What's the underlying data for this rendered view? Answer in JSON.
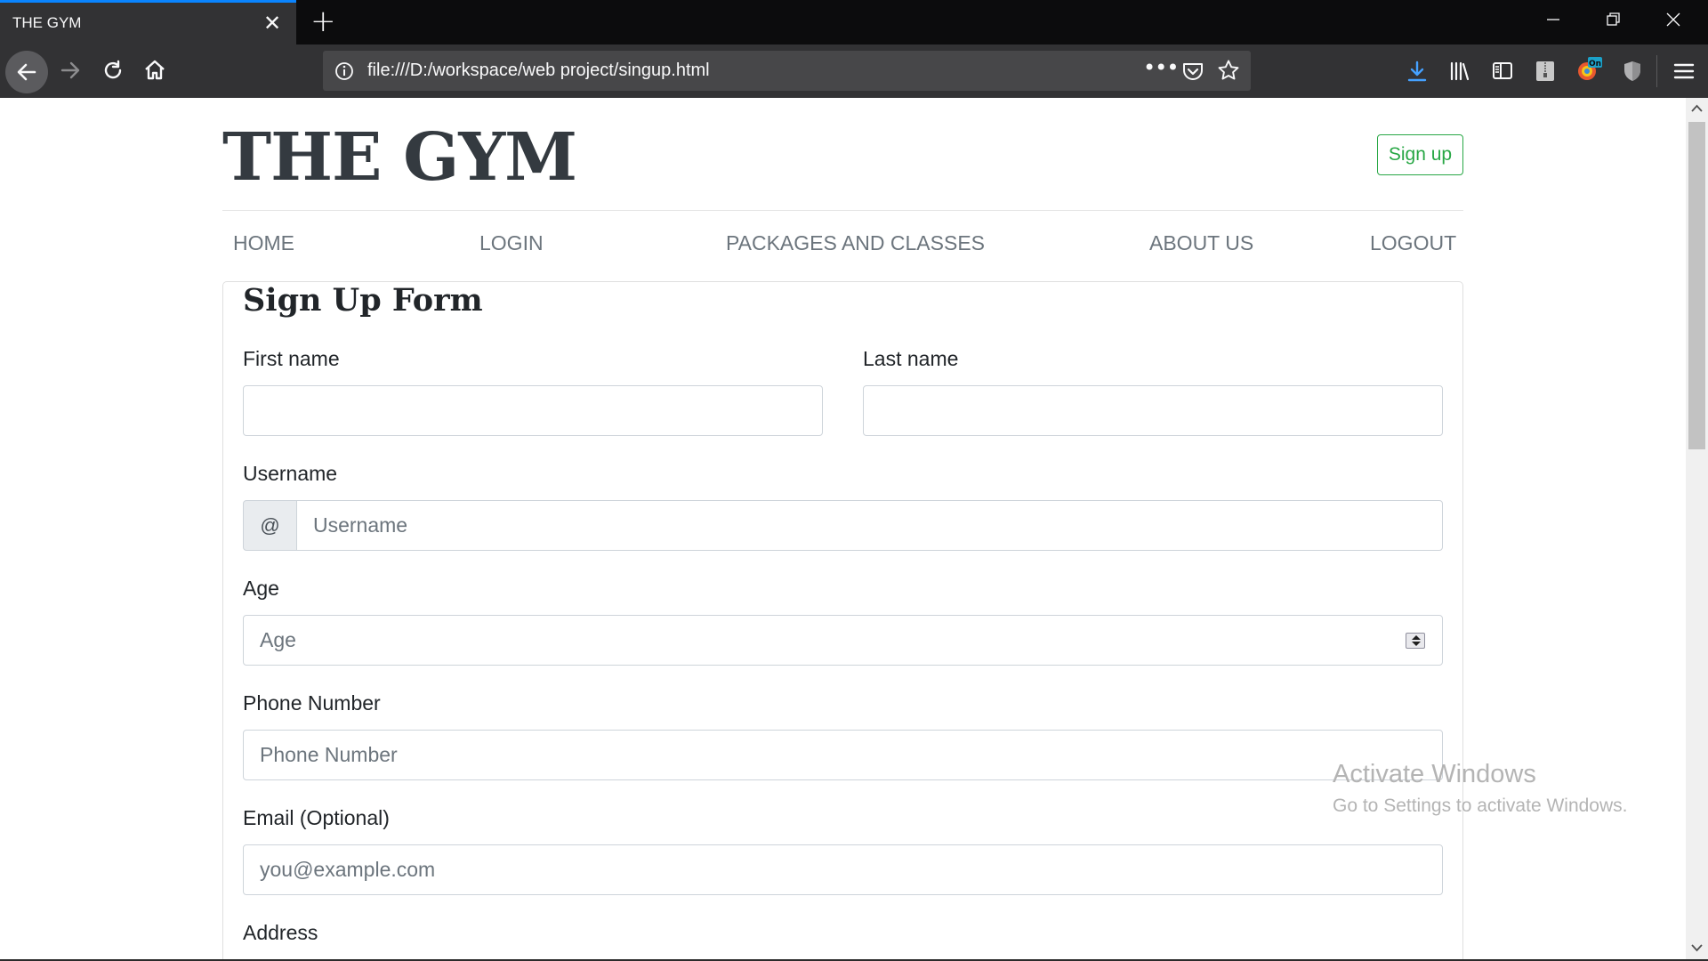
{
  "browser": {
    "tab_title": "THE GYM",
    "url": "file:///D:/workspace/web project/singup.html",
    "toolbar_badge": "On",
    "colors": {
      "chrome_bg": "#0c0c0d",
      "toolbar_bg": "#323234",
      "accent": "#0a84ff",
      "download_icon": "#45a1ff"
    }
  },
  "page": {
    "brand": "THE GYM",
    "signup_button": "Sign up",
    "nav": [
      "HOME",
      "LOGIN",
      "PACKAGES AND CLASSES",
      "ABOUT US",
      "LOGOUT"
    ],
    "colors": {
      "brand_text": "#343a40",
      "signup_green": "#28a745",
      "nav_text": "#6c757d"
    }
  },
  "form": {
    "title": "Sign Up Form",
    "first_name": {
      "label": "First name",
      "value": ""
    },
    "last_name": {
      "label": "Last name",
      "value": ""
    },
    "username": {
      "label": "Username",
      "addon": "@",
      "placeholder": "Username"
    },
    "age": {
      "label": "Age",
      "placeholder": "Age"
    },
    "phone": {
      "label": "Phone Number",
      "placeholder": "Phone Number"
    },
    "email": {
      "label": "Email (Optional)",
      "placeholder": "you@example.com"
    },
    "address": {
      "label": "Address"
    }
  },
  "watermark": {
    "title": "Activate Windows",
    "subtitle": "Go to Settings to activate Windows."
  }
}
